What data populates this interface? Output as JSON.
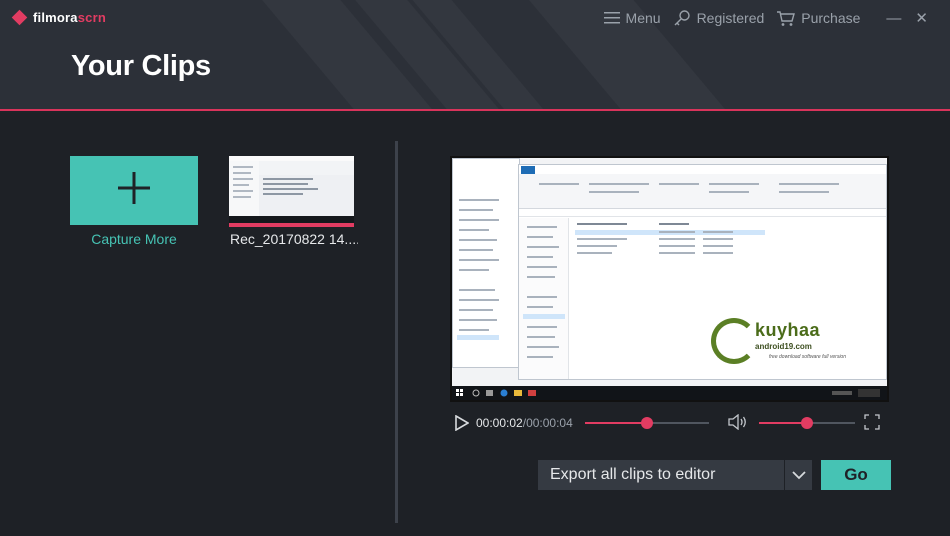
{
  "app": {
    "logo_brand": "filmora",
    "logo_suffix": "scrn",
    "page_title": "Your Clips"
  },
  "topnav": {
    "menu_label": "Menu",
    "registered_label": "Registered",
    "purchase_label": "Purchase",
    "minimize_glyph": "—",
    "close_glyph": "✕"
  },
  "clips": {
    "capture_label": "Capture More",
    "items": [
      {
        "label": "Rec_20170822 14...."
      }
    ]
  },
  "player": {
    "current_time": "00:00:02",
    "separator": "/",
    "total_time": "00:00:04",
    "progress_fraction": 0.5,
    "volume_fraction": 0.5
  },
  "preview_watermark": {
    "brand": "kuyhaa",
    "site": "android19.com",
    "tagline": "free download software full version"
  },
  "export": {
    "selected_option": "Export all clips to editor",
    "go_label": "Go"
  },
  "colors": {
    "accent_teal": "#46c3b4",
    "accent_pink": "#e23c62",
    "header_bg": "#2c3038",
    "main_bg": "#1e2126"
  },
  "icons": {
    "menu": "hamburger-icon",
    "registered": "key-icon",
    "purchase": "cart-icon",
    "capture": "plus-icon",
    "play": "play-icon",
    "volume": "volume-icon",
    "fullscreen": "fullscreen-icon",
    "dropdown": "chevron-down-icon"
  }
}
